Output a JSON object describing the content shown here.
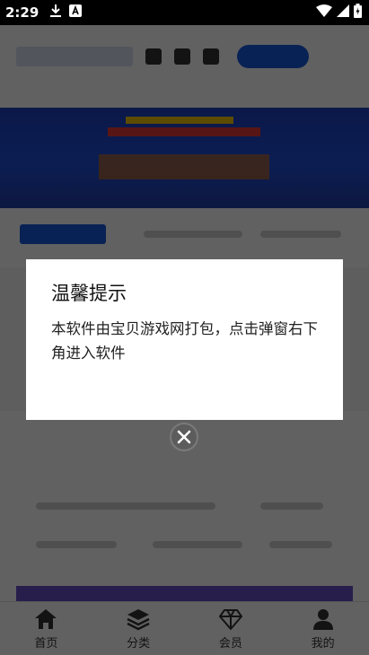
{
  "status_bar": {
    "time": "2:29",
    "icons": [
      "download-icon",
      "a-icon",
      "wifi-icon",
      "signal-icon",
      "battery-icon"
    ]
  },
  "dialog": {
    "title": "温馨提示",
    "message": "本软件由宝贝游戏网打包，点击弹窗右下角进入软件"
  },
  "close_button": {
    "icon": "close-icon"
  },
  "bottom_nav": {
    "items": [
      {
        "label": "首页",
        "icon": "home-icon"
      },
      {
        "label": "分类",
        "icon": "layers-icon"
      },
      {
        "label": "会员",
        "icon": "diamond-icon"
      },
      {
        "label": "我的",
        "icon": "user-icon"
      }
    ]
  },
  "colors": {
    "overlay": "#000000",
    "accent": "#1a5be0",
    "dialog_bg": "#ffffff"
  }
}
